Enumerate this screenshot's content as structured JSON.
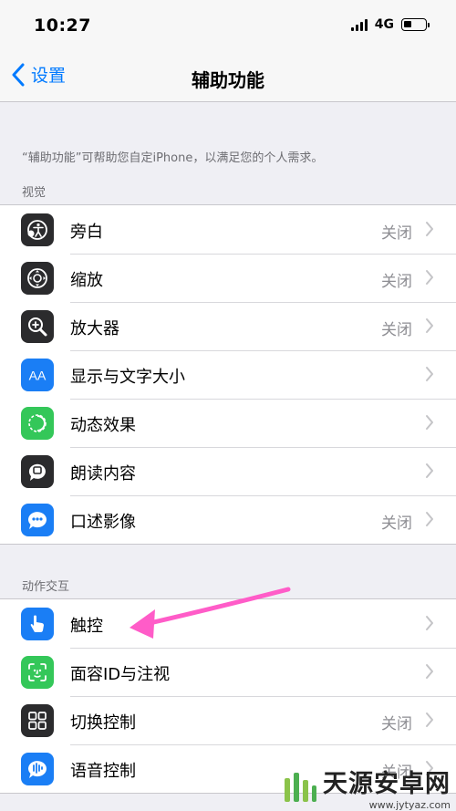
{
  "status": {
    "time": "10:27",
    "network": "4G",
    "battery_level": 0.35
  },
  "nav": {
    "back_label": "设置",
    "title": "辅助功能"
  },
  "description": "“辅助功能”可帮助您自定iPhone，以满足您的个人需求。",
  "sections": [
    {
      "header": "视觉",
      "items": [
        {
          "label": "旁白",
          "value": "关闭",
          "icon": "voiceover-icon",
          "color": "#2b2b2d"
        },
        {
          "label": "缩放",
          "value": "关闭",
          "icon": "zoom-icon",
          "color": "#2b2b2d"
        },
        {
          "label": "放大器",
          "value": "关闭",
          "icon": "magnifier-icon",
          "color": "#2b2b2d"
        },
        {
          "label": "显示与文字大小",
          "value": "",
          "icon": "text-size-icon",
          "color": "#1a7ef5"
        },
        {
          "label": "动态效果",
          "value": "",
          "icon": "motion-icon",
          "color": "#34c759"
        },
        {
          "label": "朗读内容",
          "value": "",
          "icon": "spoken-content-icon",
          "color": "#2b2b2d"
        },
        {
          "label": "口述影像",
          "value": "关闭",
          "icon": "audio-description-icon",
          "color": "#1a7ef5"
        }
      ]
    },
    {
      "header": "动作交互",
      "items": [
        {
          "label": "触控",
          "value": "",
          "icon": "touch-icon",
          "color": "#1a7ef5"
        },
        {
          "label": "面容ID与注视",
          "value": "",
          "icon": "face-id-icon",
          "color": "#34c759"
        },
        {
          "label": "切换控制",
          "value": "关闭",
          "icon": "switch-control-icon",
          "color": "#2b2b2d"
        },
        {
          "label": "语音控制",
          "value": "关闭",
          "icon": "voice-control-icon",
          "color": "#1a7ef5"
        }
      ]
    }
  ],
  "watermark": {
    "title": "天源安卓网",
    "url": "www.jytyaz.com"
  }
}
